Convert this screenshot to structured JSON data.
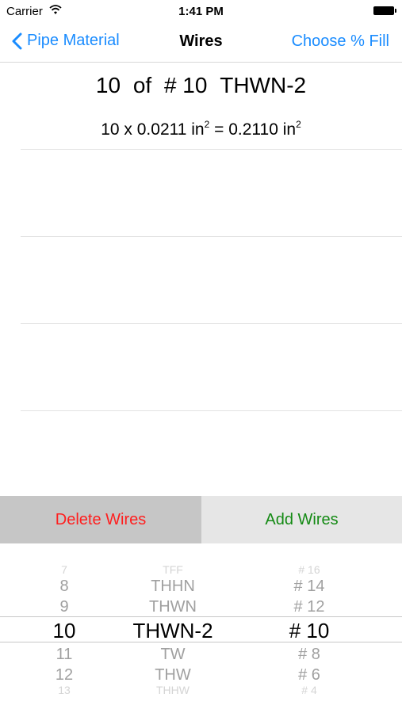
{
  "status_bar": {
    "carrier": "Carrier",
    "time": "1:41 PM"
  },
  "navbar": {
    "back_label": "Pipe Material",
    "title": "Wires",
    "right_label": "Choose % Fill"
  },
  "summary": {
    "count": "10",
    "of": "of",
    "size": "# 10",
    "type": "THWN-2"
  },
  "calculation": {
    "lhs": "10 x 0.0211 in",
    "eq": " = 0.2110 in",
    "exp": "2"
  },
  "buttons": {
    "delete": "Delete Wires",
    "add": "Add Wires"
  },
  "colors": {
    "link": "#1a8cff",
    "delete": "#ff1e1e",
    "add": "#148a14"
  },
  "picker": {
    "count": [
      "7",
      "8",
      "9",
      "10",
      "11",
      "12",
      "13"
    ],
    "type": [
      "TFF",
      "THHN",
      "THWN",
      "THWN-2",
      "TW",
      "THW",
      "THHW"
    ],
    "size": [
      "# 16",
      "# 14",
      "# 12",
      "# 10",
      "# 8",
      "# 6",
      "# 4"
    ],
    "selected_index": 3
  }
}
